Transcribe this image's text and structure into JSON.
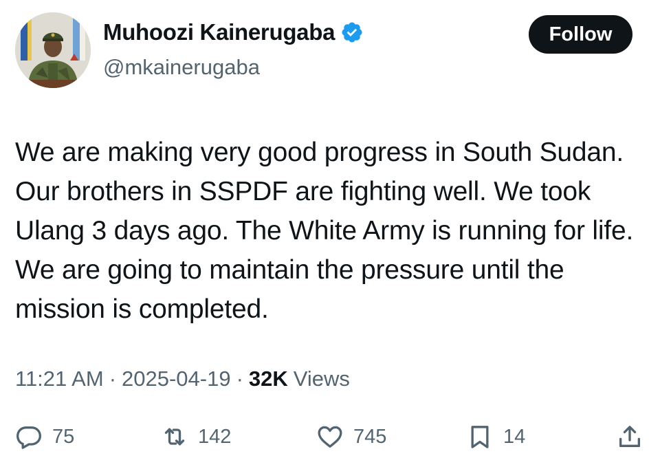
{
  "author": {
    "display_name": "Muhoozi Kainerugaba",
    "handle": "@mkainerugaba",
    "verified": true,
    "verified_color": "#1d9bf0"
  },
  "follow_button": {
    "label": "Follow"
  },
  "tweet": {
    "text": "We are making very good progress in South Sudan. Our brothers in SSPDF are fighting well. We took Ulang 3 days ago. The White Army is running for life. We are going to maintain the pressure until the mission is completed."
  },
  "meta": {
    "time": "11:21 AM",
    "separator": "·",
    "date": "2025-04-19",
    "views_count": "32K",
    "views_label": "Views"
  },
  "actions": {
    "replies": {
      "icon": "reply-icon",
      "count": "75"
    },
    "reposts": {
      "icon": "repost-icon",
      "count": "142"
    },
    "likes": {
      "icon": "heart-icon",
      "count": "745"
    },
    "bookmarks": {
      "icon": "bookmark-icon",
      "count": "14"
    },
    "share": {
      "icon": "share-icon"
    }
  },
  "colors": {
    "text_primary": "#0f1419",
    "text_secondary": "#536471",
    "follow_bg": "#0f1419",
    "follow_text": "#ffffff"
  }
}
